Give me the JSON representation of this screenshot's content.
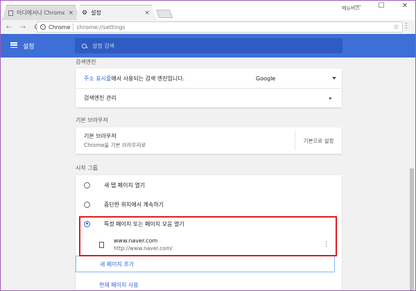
{
  "tabs": [
    {
      "title": "어디에서나 Chrome 사용",
      "close": "×"
    },
    {
      "title": "설정",
      "close": "×"
    }
  ],
  "window": {
    "user": "메뉴버스",
    "minimize": "—",
    "maximize": "☐",
    "close": "✕"
  },
  "toolbar": {
    "back": "←",
    "forward": "→",
    "reload": "C",
    "chip": "Chrome",
    "url": "chrome://settings",
    "star": "☆",
    "menu": "⋮"
  },
  "header": {
    "title": "설정",
    "search_placeholder": "설정 검색"
  },
  "search_engine": {
    "section_title": "검색엔진",
    "row1_link": "주소 표시줄",
    "row1_text": "에서 사용되는 검색 엔진입니다.",
    "engine_value": "Google",
    "row2_text": "검색엔진 관리",
    "chevron": "▸"
  },
  "default_browser": {
    "section_title": "기본 브라우저",
    "label": "기본 브라우저",
    "sublabel": "Chrome을 기본 브라우저로",
    "button": "기본으로 설정"
  },
  "startup": {
    "section_title": "시작 그룹",
    "options": [
      {
        "label": "새 탭 페이지 열기",
        "checked": false
      },
      {
        "label": "중단한 위치에서 계속하기",
        "checked": false
      },
      {
        "label": "특정 페이지 또는 페이지 모음 열기",
        "checked": true
      }
    ],
    "page": {
      "title": "www.naver.com",
      "url": "http://www.naver.com/",
      "menu": "⋮"
    },
    "add_page": "새 페이지 추가",
    "use_current": "현재 페이지 사용"
  },
  "colors": {
    "accent": "#3d6fd6",
    "link": "#3367d6",
    "highlight": "#e0191c"
  }
}
